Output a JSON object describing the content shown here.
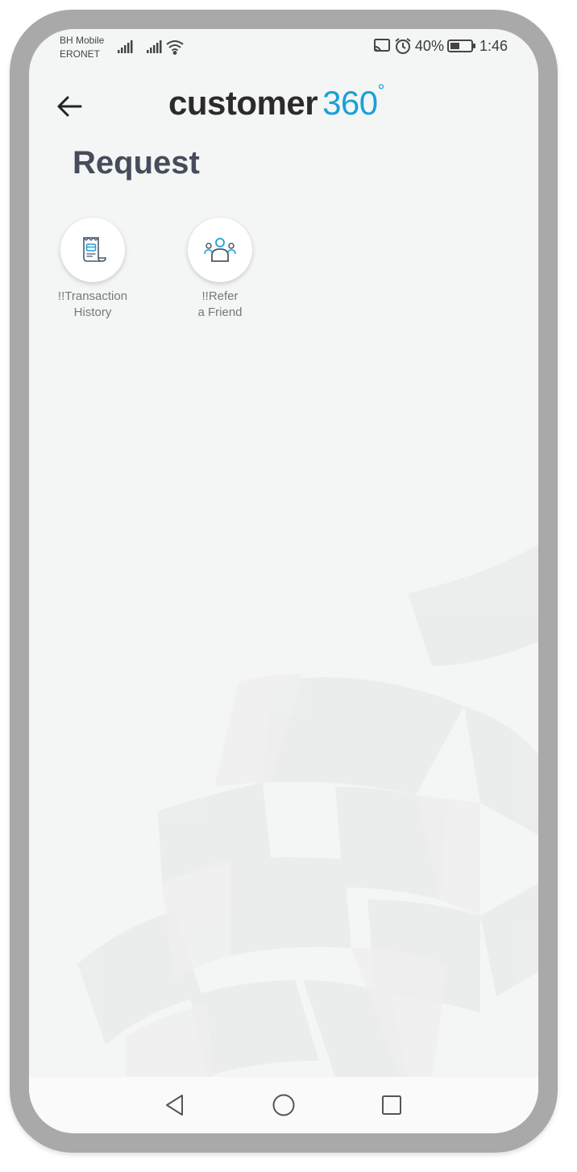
{
  "status_bar": {
    "carrier_line1": "BH Mobile",
    "carrier_line2": "ERONET",
    "battery": "40%",
    "time": "1:46",
    "icons": [
      "signal-icon",
      "signal-icon",
      "wifi-icon",
      "cast-icon",
      "alarm-icon",
      "battery-icon"
    ]
  },
  "header": {
    "back_icon": "arrow-left-icon",
    "logo_dark": "customer",
    "logo_accent": "360",
    "logo_degree": "°"
  },
  "page": {
    "title": "Request"
  },
  "tiles": [
    {
      "line1": "!!Transaction",
      "line2": "History",
      "icon": "receipt-icon"
    },
    {
      "line1": "!!Refer",
      "line2": "a Friend",
      "icon": "refer-friend-icon"
    }
  ],
  "nav": {
    "icons": [
      "nav-back-icon",
      "nav-home-icon",
      "nav-recents-icon"
    ]
  },
  "colors": {
    "accent": "#1aa0d8",
    "title": "#454d5a",
    "frame": "#a9a9a9",
    "screen_bg": "#f4f5f5"
  }
}
